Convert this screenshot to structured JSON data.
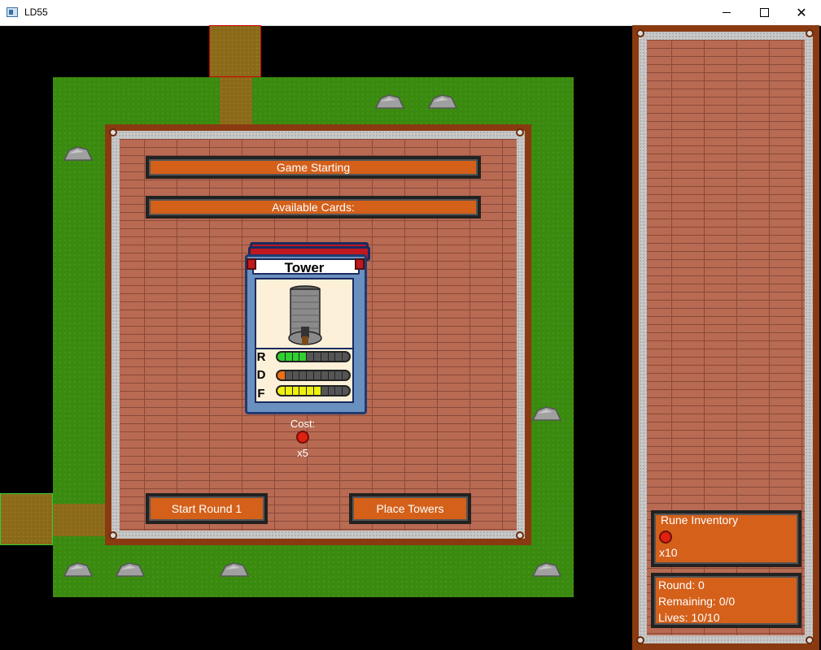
{
  "window": {
    "title": "LD55"
  },
  "dialog": {
    "status": "Game Starting",
    "cards_heading": "Available Cards:",
    "card": {
      "name": "Tower",
      "stats": [
        {
          "label": "R",
          "level": 0.4,
          "color": "#30d030"
        },
        {
          "label": "D",
          "level": 0.1,
          "color": "#f07010"
        },
        {
          "label": "F",
          "level": 0.6,
          "color": "#f0f010"
        }
      ],
      "cost_label": "Cost:",
      "cost_icon": "rune-icon",
      "cost_qty": "x5"
    },
    "buttons": {
      "start_round": "Start Round 1",
      "place_towers": "Place Towers"
    }
  },
  "sidebar": {
    "rune_inventory": {
      "title": "Rune Inventory",
      "icon": "rune-icon",
      "qty": "x10"
    },
    "stats": {
      "round": "Round: 0",
      "remaining": "Remaining: 0/0",
      "lives": "Lives: 10/10"
    }
  }
}
